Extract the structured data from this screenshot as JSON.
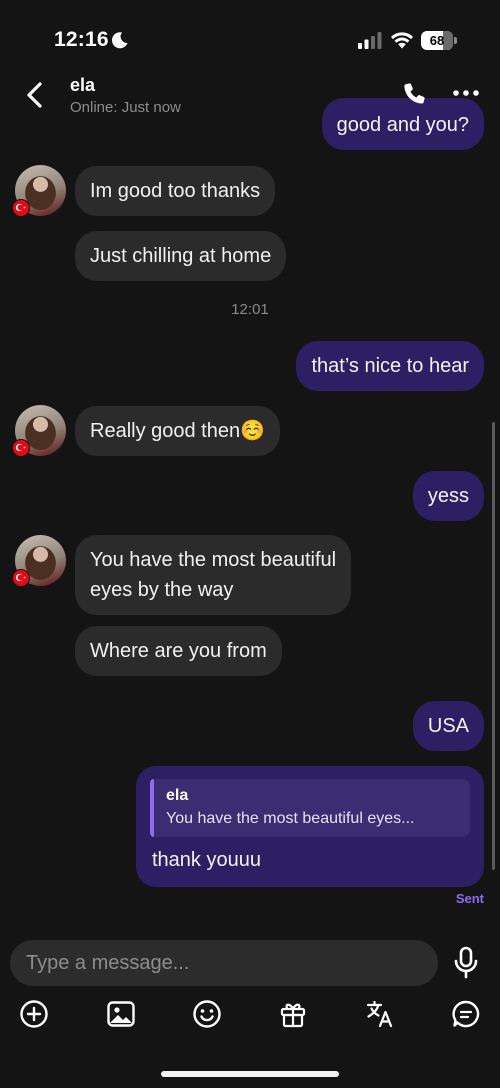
{
  "status_bar": {
    "time": "12:16",
    "battery_level": "68",
    "battery_fraction": 0.68
  },
  "header": {
    "contact_name": "ela",
    "contact_status": "Online: Just now"
  },
  "messages": [
    {
      "direction": "outgoing",
      "text": "good and you?"
    },
    {
      "direction": "incoming",
      "text": "Im good too thanks"
    },
    {
      "direction": "incoming",
      "text": "Just chilling at home"
    },
    {
      "type": "timestamp",
      "text": "12:01"
    },
    {
      "direction": "outgoing",
      "text": "that’s nice to hear"
    },
    {
      "direction": "incoming",
      "text": "Really good then☺️"
    },
    {
      "direction": "outgoing",
      "text": "yess"
    },
    {
      "direction": "incoming",
      "line1": "You have the most beautiful",
      "line2": "eyes by the way"
    },
    {
      "direction": "incoming",
      "text": "Where are you from"
    },
    {
      "direction": "outgoing",
      "text": "USA"
    },
    {
      "direction": "outgoing",
      "reply_to": {
        "name": "ela",
        "text": "You have the most beautiful eyes..."
      },
      "text": "thank youuu",
      "status": "Sent"
    }
  ],
  "composer": {
    "placeholder": "Type a message..."
  },
  "toolbar": {
    "icons": [
      "add-icon",
      "image-icon",
      "emoji-icon",
      "gift-icon",
      "translate-icon",
      "chat-bubble-icon"
    ]
  },
  "colors": {
    "background": "#141414",
    "incoming_bubble": "#2b2b2b",
    "outgoing_bubble": "#2d1f63",
    "accent": "#8b6cf0"
  }
}
